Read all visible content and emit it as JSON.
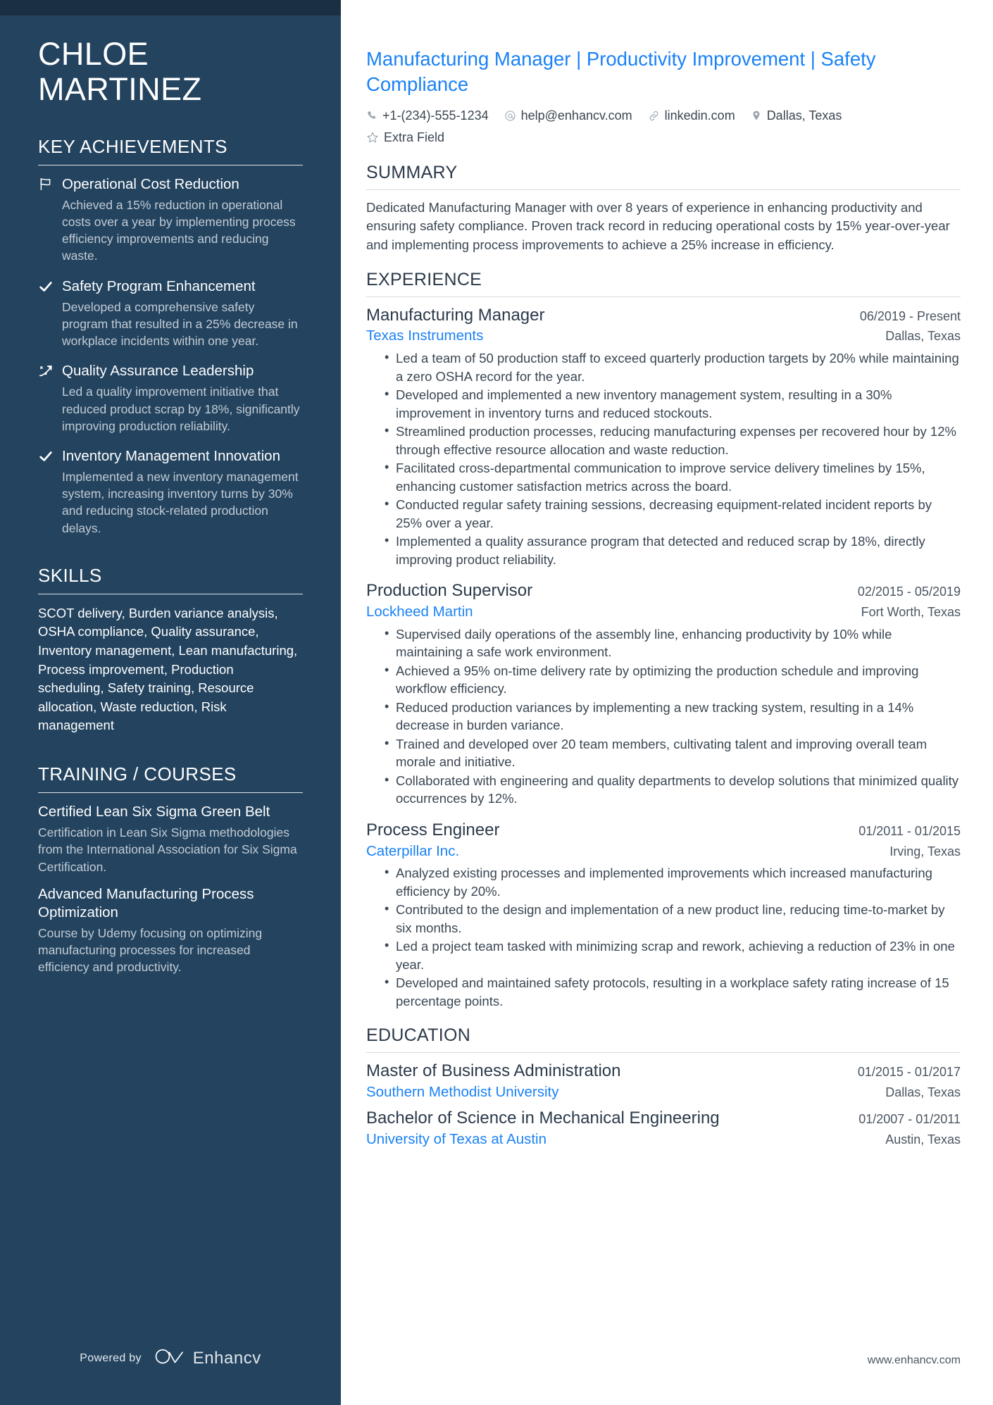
{
  "sidebar": {
    "name_lines": [
      "CHLOE",
      "MARTINEZ"
    ],
    "achievements_heading": "KEY ACHIEVEMENTS",
    "achievements": [
      {
        "icon": "flag-icon",
        "title": "Operational Cost Reduction",
        "description": "Achieved a 15% reduction in operational costs over a year by implementing process efficiency improvements and reducing waste."
      },
      {
        "icon": "check-icon",
        "title": "Safety Program Enhancement",
        "description": "Developed a comprehensive safety program that resulted in a 25% decrease in workplace incidents within one year."
      },
      {
        "icon": "sparkle-arrow-icon",
        "title": "Quality Assurance Leadership",
        "description": "Led a quality improvement initiative that reduced product scrap by 18%, significantly improving production reliability."
      },
      {
        "icon": "check-icon",
        "title": "Inventory Management Innovation",
        "description": "Implemented a new inventory management system, increasing inventory turns by 30% and reducing stock-related production delays."
      }
    ],
    "skills_heading": "SKILLS",
    "skills_text": "SCOT delivery, Burden variance analysis, OSHA compliance, Quality assurance, Inventory management, Lean manufacturing, Process improvement, Production scheduling, Safety training, Resource allocation, Waste reduction, Risk management",
    "training_heading": "TRAINING / COURSES",
    "courses": [
      {
        "title": "Certified Lean Six Sigma Green Belt",
        "description": "Certification in Lean Six Sigma methodologies from the International Association for Six Sigma Certification."
      },
      {
        "title": "Advanced Manufacturing Process Optimization",
        "description": "Course by Udemy focusing on optimizing manufacturing processes for increased efficiency and productivity."
      }
    ],
    "footer": {
      "powered_by": "Powered by",
      "brand": "Enhancv"
    }
  },
  "main": {
    "headline": "Manufacturing Manager | Productivity Improvement | Safety Compliance",
    "contacts_row1": [
      {
        "icon": "phone-icon",
        "text": "+1-(234)-555-1234"
      },
      {
        "icon": "email-icon",
        "text": "help@enhancv.com"
      },
      {
        "icon": "link-icon",
        "text": "linkedin.com"
      },
      {
        "icon": "location-pin-icon",
        "text": "Dallas, Texas"
      }
    ],
    "contacts_row2": [
      {
        "icon": "star-icon",
        "text": "Extra Field"
      }
    ],
    "summary_heading": "SUMMARY",
    "summary_text": "Dedicated Manufacturing Manager with over 8 years of experience in enhancing productivity and ensuring safety compliance. Proven track record in reducing operational costs by 15% year-over-year and implementing process improvements to achieve a 25% increase in efficiency.",
    "experience_heading": "EXPERIENCE",
    "experience": [
      {
        "title": "Manufacturing Manager",
        "date": "06/2019 - Present",
        "org": "Texas Instruments",
        "location": "Dallas, Texas",
        "bullets": [
          "Led a team of 50 production staff to exceed quarterly production targets by 20% while maintaining a zero OSHA record for the year.",
          "Developed and implemented a new inventory management system, resulting in a 30% improvement in inventory turns and reduced stockouts.",
          "Streamlined production processes, reducing manufacturing expenses per recovered hour by 12% through effective resource allocation and waste reduction.",
          "Facilitated cross-departmental communication to improve service delivery timelines by 15%, enhancing customer satisfaction metrics across the board.",
          "Conducted regular safety training sessions, decreasing equipment-related incident reports by 25% over a year.",
          "Implemented a quality assurance program that detected and reduced scrap by 18%, directly improving product reliability."
        ]
      },
      {
        "title": "Production Supervisor",
        "date": "02/2015 - 05/2019",
        "org": "Lockheed Martin",
        "location": "Fort Worth, Texas",
        "bullets": [
          "Supervised daily operations of the assembly line, enhancing productivity by 10% while maintaining a safe work environment.",
          "Achieved a 95% on-time delivery rate by optimizing the production schedule and improving workflow efficiency.",
          "Reduced production variances by implementing a new tracking system, resulting in a 14% decrease in burden variance.",
          "Trained and developed over 20 team members, cultivating talent and improving overall team morale and initiative.",
          "Collaborated with engineering and quality departments to develop solutions that minimized quality occurrences by 12%."
        ]
      },
      {
        "title": "Process Engineer",
        "date": "01/2011 - 01/2015",
        "org": "Caterpillar Inc.",
        "location": "Irving, Texas",
        "bullets": [
          "Analyzed existing processes and implemented improvements which increased manufacturing efficiency by 20%.",
          "Contributed to the design and implementation of a new product line, reducing time-to-market by six months.",
          "Led a project team tasked with minimizing scrap and rework, achieving a reduction of 23% in one year.",
          "Developed and maintained safety protocols, resulting in a workplace safety rating increase of 15 percentage points."
        ]
      }
    ],
    "education_heading": "EDUCATION",
    "education": [
      {
        "title": "Master of Business Administration",
        "date": "01/2015 - 01/2017",
        "org": "Southern Methodist University",
        "location": "Dallas, Texas"
      },
      {
        "title": "Bachelor of Science in Mechanical Engineering",
        "date": "01/2007 - 01/2011",
        "org": "University of Texas at Austin",
        "location": "Austin, Texas"
      }
    ],
    "footer_url": "www.enhancv.com"
  },
  "colors": {
    "sidebar_bg": "#23435f",
    "sidebar_top_strip": "#1b2f42",
    "accent_blue": "#1a82f5",
    "body_text": "#3b4753"
  }
}
